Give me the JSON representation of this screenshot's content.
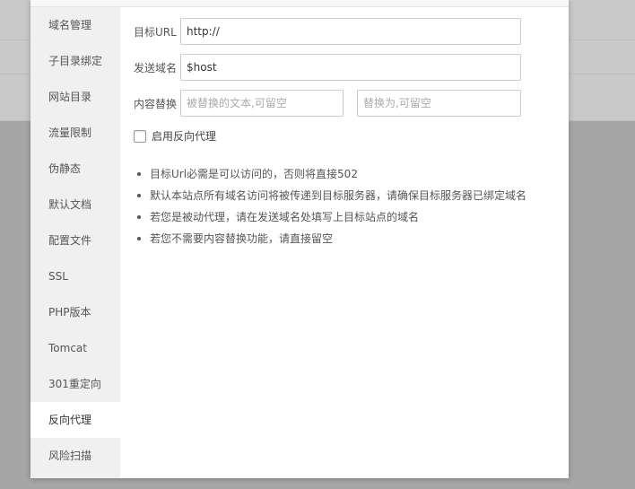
{
  "sidebar": {
    "items": [
      {
        "label": "域名管理"
      },
      {
        "label": "子目录绑定"
      },
      {
        "label": "网站目录"
      },
      {
        "label": "流量限制"
      },
      {
        "label": "伪静态"
      },
      {
        "label": "默认文档"
      },
      {
        "label": "配置文件"
      },
      {
        "label": "SSL"
      },
      {
        "label": "PHP版本"
      },
      {
        "label": "Tomcat"
      },
      {
        "label": "301重定向"
      },
      {
        "label": "反向代理",
        "active": true
      },
      {
        "label": "风险扫描"
      }
    ]
  },
  "form": {
    "target_url": {
      "label": "目标URL",
      "value": "http://"
    },
    "send_domain": {
      "label": "发送域名",
      "value": "$host"
    },
    "replace": {
      "label": "内容替换",
      "from_placeholder": "被替换的文本,可留空",
      "to_placeholder": "替换为,可留空"
    },
    "enable_proxy": {
      "label": "启用反向代理",
      "checked": false
    }
  },
  "tips": [
    "目标Url必需是可以访问的，否则将直接502",
    "默认本站点所有域名访问将被传递到目标服务器，请确保目标服务器已绑定域名",
    "若您是被动代理，请在发送域名处填写上目标站点的域名",
    "若您不需要内容替换功能，请直接留空"
  ]
}
